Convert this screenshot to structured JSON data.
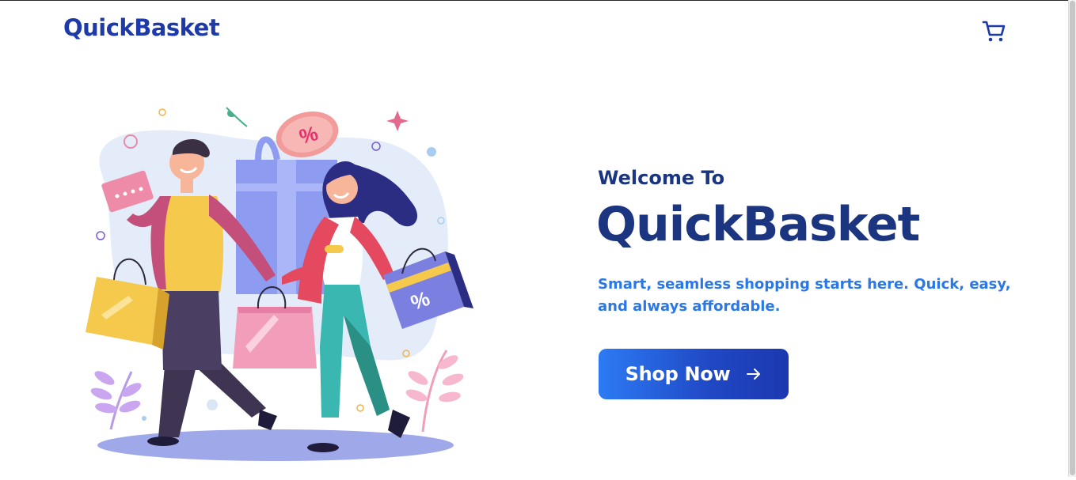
{
  "header": {
    "logo_text": "QuickBasket",
    "cart_icon": "shopping-cart-icon"
  },
  "hero": {
    "welcome_text": "Welcome To",
    "brand_text": "QuickBasket",
    "tagline": "Smart, seamless shopping starts here. Quick, easy, and always affordable.",
    "cta_label": "Shop Now",
    "cta_icon": "arrow-right-icon",
    "illustration_badge": "%",
    "illustration_name": "couple-shopping-illustration"
  },
  "colors": {
    "brand_navy": "#1b3580",
    "logo_blue": "#1e3aa8",
    "tagline_blue": "#2a77e8",
    "button_gradient_start": "#2c7bf4",
    "button_gradient_end": "#1c38b0"
  }
}
